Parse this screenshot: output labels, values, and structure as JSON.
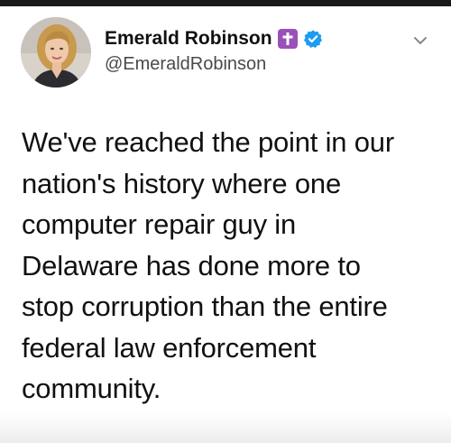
{
  "author": {
    "display_name": "Emerald Robinson",
    "handle": "@EmeraldRobinson",
    "cross_badge_icon": "latin-cross-icon",
    "verified_icon": "verified-badge-icon",
    "cross_badge_color": "#9b4fb8",
    "verified_color": "#1d9bf0"
  },
  "menu": {
    "icon": "chevron-down-icon"
  },
  "tweet": {
    "lines": [
      "We've reached the point in our",
      "nation's history where one",
      "computer repair guy in",
      "Delaware has done more to",
      "stop corruption than the entire",
      "federal law enforcement",
      "community."
    ]
  }
}
